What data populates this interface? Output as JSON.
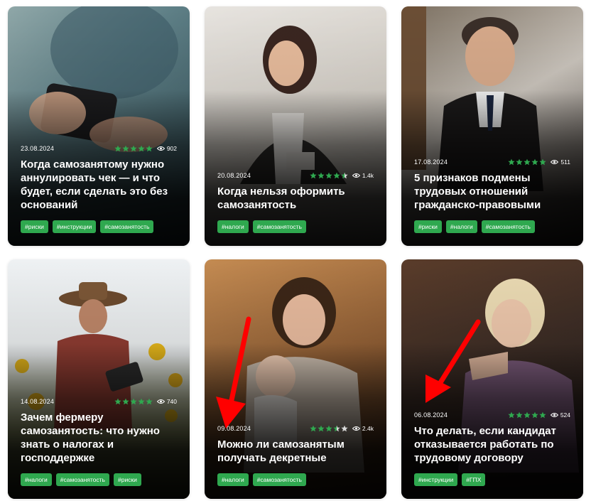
{
  "colors": {
    "tag_bg": "#2fa84f",
    "star_fill": "#2fa84f",
    "star_empty": "#d9d9d9",
    "arrow": "#ff0000"
  },
  "icons": {
    "views": "eye-icon",
    "rating": "star-icon"
  },
  "cards": [
    {
      "date": "23.08.2024",
      "rating": 5,
      "views": "902",
      "title": "Когда самозанятому нужно аннулировать чек — и что будет, если сделать это без оснований",
      "tags": [
        "#риски",
        "#инструкции",
        "#самозанятость"
      ]
    },
    {
      "date": "20.08.2024",
      "rating": 4.5,
      "views": "1.4k",
      "title": "Когда нельзя оформить самозанятость",
      "tags": [
        "#налоги",
        "#самозанятость"
      ]
    },
    {
      "date": "17.08.2024",
      "rating": 5,
      "views": "511",
      "title": "5 признаков подмены трудовых отношений гражданско-правовыми",
      "tags": [
        "#риски",
        "#налоги",
        "#самозанятость"
      ]
    },
    {
      "date": "14.08.2024",
      "rating": 5,
      "views": "740",
      "title": "Зачем фермеру самозанятость: что нужно знать о налогах и господдержке",
      "tags": [
        "#налоги",
        "#самозанятость",
        "#риски"
      ]
    },
    {
      "date": "09.08.2024",
      "rating": 3.5,
      "views": "2.4k",
      "title": "Можно ли самозанятым получать декретные",
      "tags": [
        "#налоги",
        "#самозанятость"
      ]
    },
    {
      "date": "06.08.2024",
      "rating": 5,
      "views": "524",
      "title": "Что делать, если кандидат отказывается работать по трудовому договору",
      "tags": [
        "#инструкции",
        "#ГПХ"
      ]
    }
  ]
}
